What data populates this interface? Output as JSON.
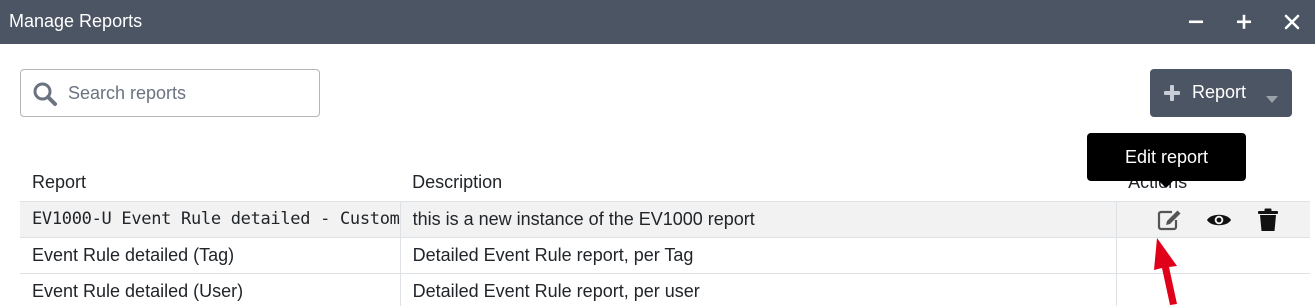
{
  "window": {
    "title": "Manage Reports",
    "controls": [
      "minimize-icon",
      "maximize-icon",
      "close-icon"
    ]
  },
  "search": {
    "placeholder": "Search reports",
    "value": "",
    "icon": "search-icon"
  },
  "toolbar": {
    "report_button_label": "Report",
    "report_button_icon": "plus-icon",
    "report_button_caret": "caret-down-icon"
  },
  "tooltip": {
    "text": "Edit report"
  },
  "table": {
    "columns": [
      "Report",
      "Description",
      "Actions"
    ],
    "rows": [
      {
        "report": "EV1000-U Event Rule detailed - Custom",
        "description": "this is a new instance of the EV1000 report",
        "actions": [
          "edit-icon",
          "view-icon",
          "delete-icon"
        ]
      },
      {
        "report": "Event Rule detailed (Tag)",
        "description": "Detailed Event Rule report, per Tag",
        "actions": []
      },
      {
        "report": "Event Rule detailed (User)",
        "description": "Detailed Event Rule report, per user",
        "actions": []
      }
    ]
  },
  "colors": {
    "titlebar": "#4b5563",
    "button": "#4b5563",
    "tooltip": "#000000",
    "annotation_arrow": "#e0001a",
    "row_highlight": "#f2f2f2"
  }
}
